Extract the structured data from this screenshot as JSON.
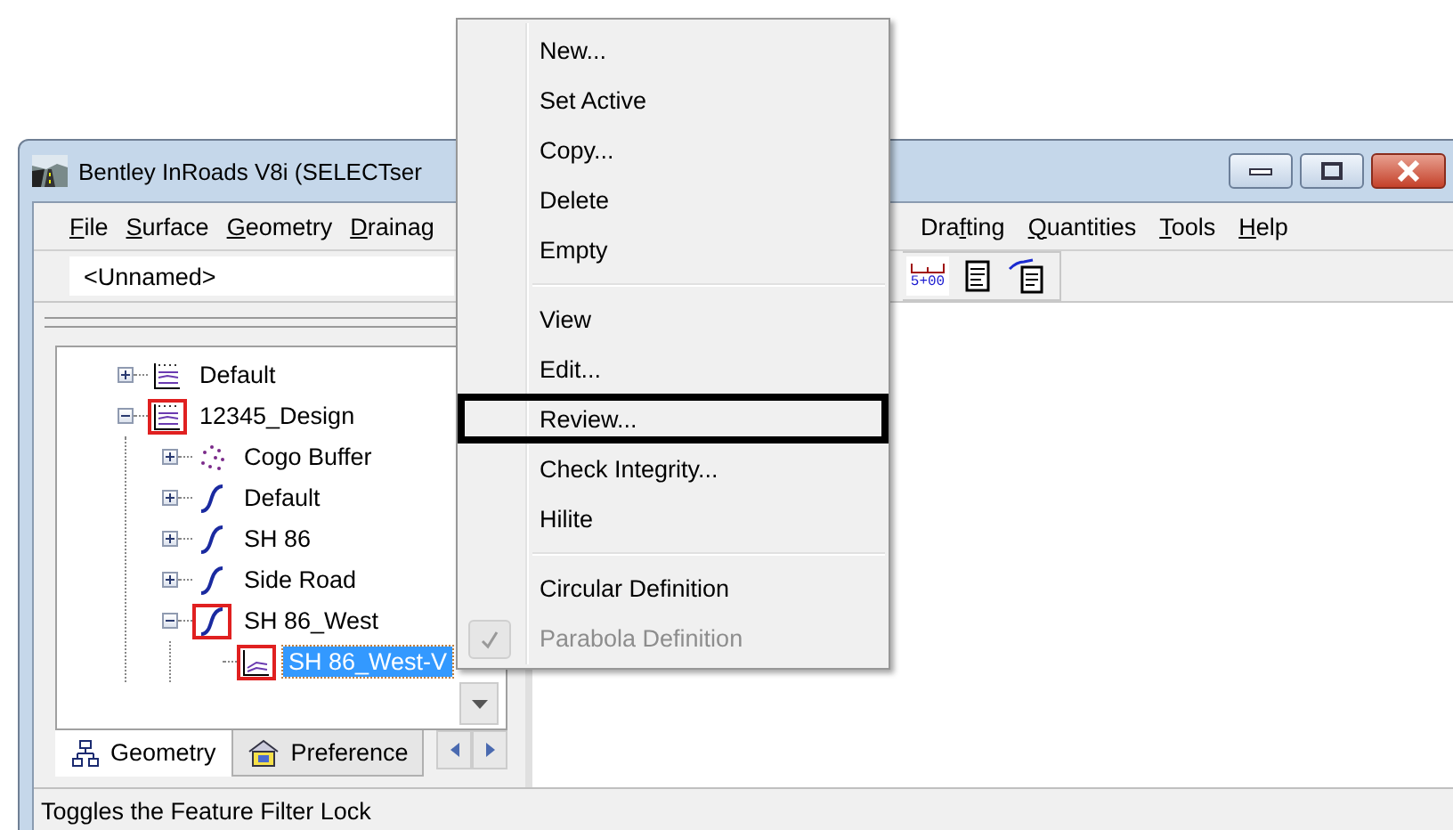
{
  "window": {
    "title": "Bentley InRoads V8i (SELECTser"
  },
  "menu_bar": {
    "left": [
      {
        "key": "F",
        "post": "ile"
      },
      {
        "key": "S",
        "post": "urface"
      },
      {
        "key": "G",
        "post": "eometry"
      },
      {
        "key": "D",
        "post": "rainag"
      }
    ],
    "right": [
      {
        "pre": "Dra",
        "key": "f",
        "post": "ting"
      },
      {
        "key": "Q",
        "post": "uantities"
      },
      {
        "key": "T",
        "post": "ools"
      },
      {
        "key": "H",
        "post": "elp"
      }
    ]
  },
  "toolbar": {
    "combo": {
      "value": "<Unnamed>"
    },
    "station_label": "5+00"
  },
  "tree": [
    {
      "label": "Default",
      "kind": "project",
      "expanded": false,
      "active": false,
      "selected": false
    },
    {
      "label": "12345_Design",
      "kind": "project",
      "expanded": true,
      "active": true,
      "selected": false,
      "children": [
        {
          "label": "Cogo Buffer",
          "kind": "cogo",
          "expanded": false,
          "active": false,
          "selected": false
        },
        {
          "label": "Default",
          "kind": "horizontal",
          "expanded": false,
          "active": false,
          "selected": false
        },
        {
          "label": "SH 86",
          "kind": "horizontal",
          "expanded": false,
          "active": false,
          "selected": false
        },
        {
          "label": "Side Road",
          "kind": "horizontal",
          "expanded": false,
          "active": false,
          "selected": false
        },
        {
          "label": "SH 86_West",
          "kind": "horizontal",
          "expanded": true,
          "active": true,
          "selected": false,
          "children": [
            {
              "label": "SH 86_West-V",
              "kind": "vertical",
              "active": true,
              "selected": true
            }
          ]
        }
      ]
    }
  ],
  "tabs": [
    {
      "label": "Geometry",
      "kind": "geometry",
      "selected": true
    },
    {
      "label": "Preference",
      "kind": "preference",
      "selected": false
    }
  ],
  "status_bar": {
    "text": "Toggles the Feature Filter Lock"
  },
  "context_menu": [
    {
      "kind": "item",
      "label": "New...",
      "disabled": false,
      "checked": false,
      "highlighted": false
    },
    {
      "kind": "item",
      "label": "Set Active",
      "disabled": false,
      "checked": false,
      "highlighted": false
    },
    {
      "kind": "item",
      "label": "Copy...",
      "disabled": false,
      "checked": false,
      "highlighted": false
    },
    {
      "kind": "item",
      "label": "Delete",
      "disabled": false,
      "checked": false,
      "highlighted": false
    },
    {
      "kind": "item",
      "label": "Empty",
      "disabled": false,
      "checked": false,
      "highlighted": false
    },
    {
      "kind": "separator"
    },
    {
      "kind": "item",
      "label": "View",
      "disabled": false,
      "checked": false,
      "highlighted": false
    },
    {
      "kind": "item",
      "label": "Edit...",
      "disabled": false,
      "checked": false,
      "highlighted": false
    },
    {
      "kind": "item",
      "label": "Review...",
      "disabled": false,
      "checked": false,
      "highlighted": true
    },
    {
      "kind": "item",
      "label": "Check Integrity...",
      "disabled": false,
      "checked": false,
      "highlighted": false
    },
    {
      "kind": "item",
      "label": "Hilite",
      "disabled": false,
      "checked": false,
      "highlighted": false
    },
    {
      "kind": "separator"
    },
    {
      "kind": "item",
      "label": "Circular Definition",
      "disabled": false,
      "checked": false,
      "highlighted": false
    },
    {
      "kind": "item",
      "label": "Parabola Definition",
      "disabled": true,
      "checked": true,
      "highlighted": false
    }
  ]
}
